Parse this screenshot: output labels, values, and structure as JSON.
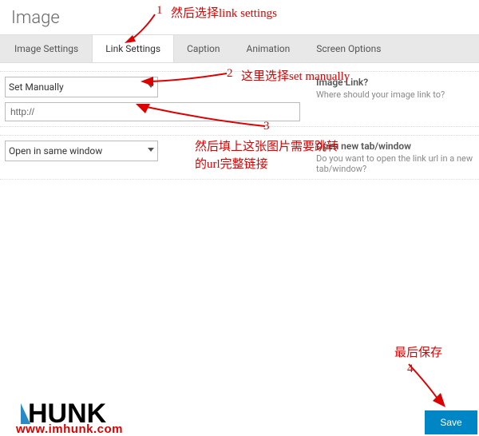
{
  "header": {
    "title": "Image"
  },
  "tabs": [
    {
      "label": "Image Settings"
    },
    {
      "label": "Link Settings"
    },
    {
      "label": "Caption"
    },
    {
      "label": "Animation"
    },
    {
      "label": "Screen Options"
    }
  ],
  "active_tab": 1,
  "link_select": {
    "value": "Set Manually",
    "label": "Image Link?",
    "desc": "Where should your image link to?"
  },
  "url_input": {
    "value": "http://"
  },
  "target_select": {
    "value": "Open in same window",
    "label": "Open new tab/window",
    "desc": "Do you want to open the link url in a new tab/window?"
  },
  "buttons": {
    "save": "Save"
  },
  "annotations": {
    "a1_num": "1",
    "a1": "然后选择link settings",
    "a2_num": "2",
    "a2": "这里选择set manually",
    "a3_num": "3",
    "a3a": "然后填上这张图片需要跳转",
    "a3b": "的url完整链接",
    "a4_num": "4",
    "a4": "最后保存"
  },
  "branding": {
    "logo_text": "HUNK",
    "site": "www.imhunk.com"
  }
}
